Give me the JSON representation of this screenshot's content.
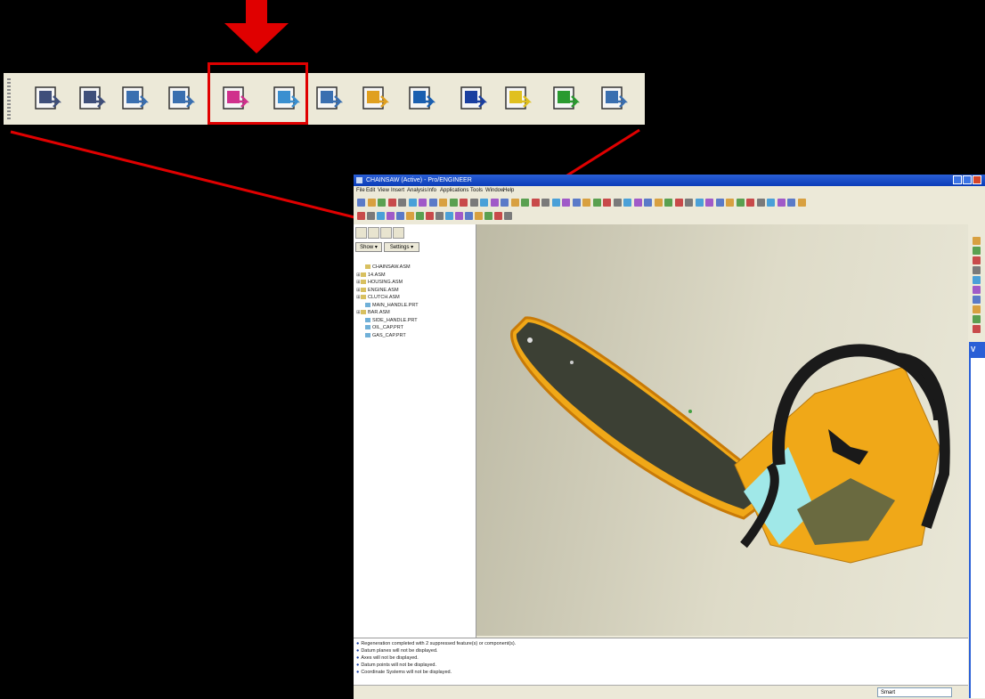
{
  "toolbar_zoom": {
    "buttons": [
      {
        "name": "create-tool-icon",
        "color": "#3f4f7a"
      },
      {
        "name": "edit-definition-icon",
        "color": "#3f4f7a"
      },
      {
        "name": "reorder-icon",
        "color": "#3a6fb0"
      },
      {
        "name": "restore-icon",
        "color": "#3a6fb0"
      },
      {
        "name": "import-arrow-left-icon",
        "color": "#d0308c"
      },
      {
        "name": "export-arrow-right-icon",
        "color": "#3a8fd0"
      },
      {
        "name": "regenerate-icon",
        "color": "#3a6fb0"
      },
      {
        "name": "lightning-check-icon",
        "color": "#e0a020"
      },
      {
        "name": "tree-hierarchy-icon",
        "color": "#1a5fb0"
      },
      {
        "name": "info-pin-icon",
        "color": "#1a3fa0"
      },
      {
        "name": "question-help-icon",
        "color": "#e0c020"
      },
      {
        "name": "refresh-icon",
        "color": "#2a9a30"
      },
      {
        "name": "checklist-icon",
        "color": "#3a6fb0"
      }
    ],
    "highlight_color": "#e00000"
  },
  "window": {
    "title": "CHAINSAW (Active) - Pro/ENGINEER",
    "menu": [
      "File",
      "Edit",
      "View",
      "Insert",
      "Analysis",
      "Info",
      "Applications",
      "Tools",
      "Window",
      "Help"
    ]
  },
  "tree": {
    "show_label": "Show ▾",
    "settings_label": "Settings ▾",
    "items": [
      {
        "label": "CHAINSAW.ASM",
        "expander": "",
        "icon_color": "#d8c060"
      },
      {
        "label": "14.ASM",
        "expander": "⊞",
        "icon_color": "#d8c060"
      },
      {
        "label": "HOUSING.ASM",
        "expander": "⊞",
        "icon_color": "#d8c060"
      },
      {
        "label": "ENGINE.ASM",
        "expander": "⊞",
        "icon_color": "#d8c060"
      },
      {
        "label": "CLUTCH.ASM",
        "expander": "⊞",
        "icon_color": "#d8c060"
      },
      {
        "label": "MAIN_HANDLE.PRT",
        "expander": "",
        "icon_color": "#70b0d8"
      },
      {
        "label": "BAR.ASM",
        "expander": "⊞",
        "icon_color": "#d8c060"
      },
      {
        "label": "SIDE_HANDLE.PRT",
        "expander": "",
        "icon_color": "#70b0d8"
      },
      {
        "label": "OIL_CAP.PRT",
        "expander": "",
        "icon_color": "#70b0d8"
      },
      {
        "label": "GAS_CAP.PRT",
        "expander": "",
        "icon_color": "#70b0d8"
      }
    ]
  },
  "messages": [
    "Regeneration completed with 2 suppressed feature(s) or component(s).",
    "Datum planes will not be displayed.",
    "Axes will not be displayed.",
    "Datum points will not be displayed.",
    "Coordinate Systems will not be displayed."
  ],
  "status": {
    "filter_value": "Smart"
  },
  "dialog": {
    "title_char": "V"
  },
  "colors": {
    "accent_red": "#e00000",
    "xp_blue": "#0a3cb8",
    "saw_orange": "#f0a818",
    "bar_dark": "#3c4034"
  }
}
